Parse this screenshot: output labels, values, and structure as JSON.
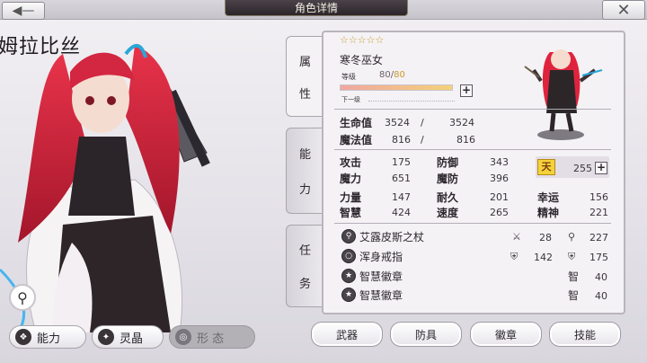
{
  "header": {
    "title": "角色详情",
    "back_icon": "arrow-left-icon",
    "close_icon": "close-icon"
  },
  "character": {
    "name_partial": "姆拉比丝"
  },
  "left_tabs": [
    {
      "label": "能力",
      "icon": "ability-icon",
      "state": "active"
    },
    {
      "label": "灵晶",
      "icon": "gem-icon",
      "state": "normal"
    },
    {
      "label": "形 态",
      "icon": "form-icon",
      "state": "disabled"
    }
  ],
  "side_tabs": [
    {
      "chars": [
        "属",
        "性"
      ]
    },
    {
      "chars": [
        "能",
        "力"
      ]
    },
    {
      "chars": [
        "任",
        "务"
      ]
    }
  ],
  "profile": {
    "stars": "☆☆☆☆☆",
    "job": "寒冬巫女",
    "level_label": "等级",
    "level": "80",
    "level_sep": "/",
    "level_cap": "80",
    "level_progress": 1.0,
    "next_label": "下一级",
    "next_value": "......"
  },
  "vitals": [
    {
      "label": "生命值",
      "current": "3524",
      "sep": "/",
      "max": "3524"
    },
    {
      "label": "魔法值",
      "current": "816",
      "sep": "/",
      "max": "816"
    }
  ],
  "abilities": {
    "col1": [
      {
        "label": "攻击",
        "value": "175"
      },
      {
        "label": "魔力",
        "value": "651"
      },
      {
        "label": "力量",
        "value": "147"
      },
      {
        "label": "智慧",
        "value": "424"
      }
    ],
    "col2": [
      {
        "label": "防御",
        "value": "343"
      },
      {
        "label": "魔防",
        "value": "396"
      },
      {
        "label": "耐久",
        "value": "201"
      },
      {
        "label": "速度",
        "value": "265"
      }
    ],
    "col3": [
      {
        "label": "幸运",
        "value": "156"
      },
      {
        "label": "精神",
        "value": "221"
      }
    ],
    "sky_points": {
      "icon_text": "天",
      "value": "255"
    }
  },
  "equipment": [
    {
      "name": "艾露皮斯之杖",
      "stats": [
        {
          "icon": "sword-icon",
          "value": "28"
        },
        {
          "icon": "wand-icon",
          "value": "227"
        }
      ]
    },
    {
      "name": "浑身戒指",
      "stats": [
        {
          "icon": "shield-icon",
          "value": "142"
        },
        {
          "icon": "magic-shield-icon",
          "value": "175"
        }
      ]
    },
    {
      "name": "智慧徽章",
      "stats": [
        {
          "label": "智",
          "value": "40"
        }
      ]
    },
    {
      "name": "智慧徽章",
      "stats": [
        {
          "label": "智",
          "value": "40"
        }
      ]
    }
  ],
  "bottom_buttons": [
    "武器",
    "防具",
    "徽章",
    "技能"
  ]
}
